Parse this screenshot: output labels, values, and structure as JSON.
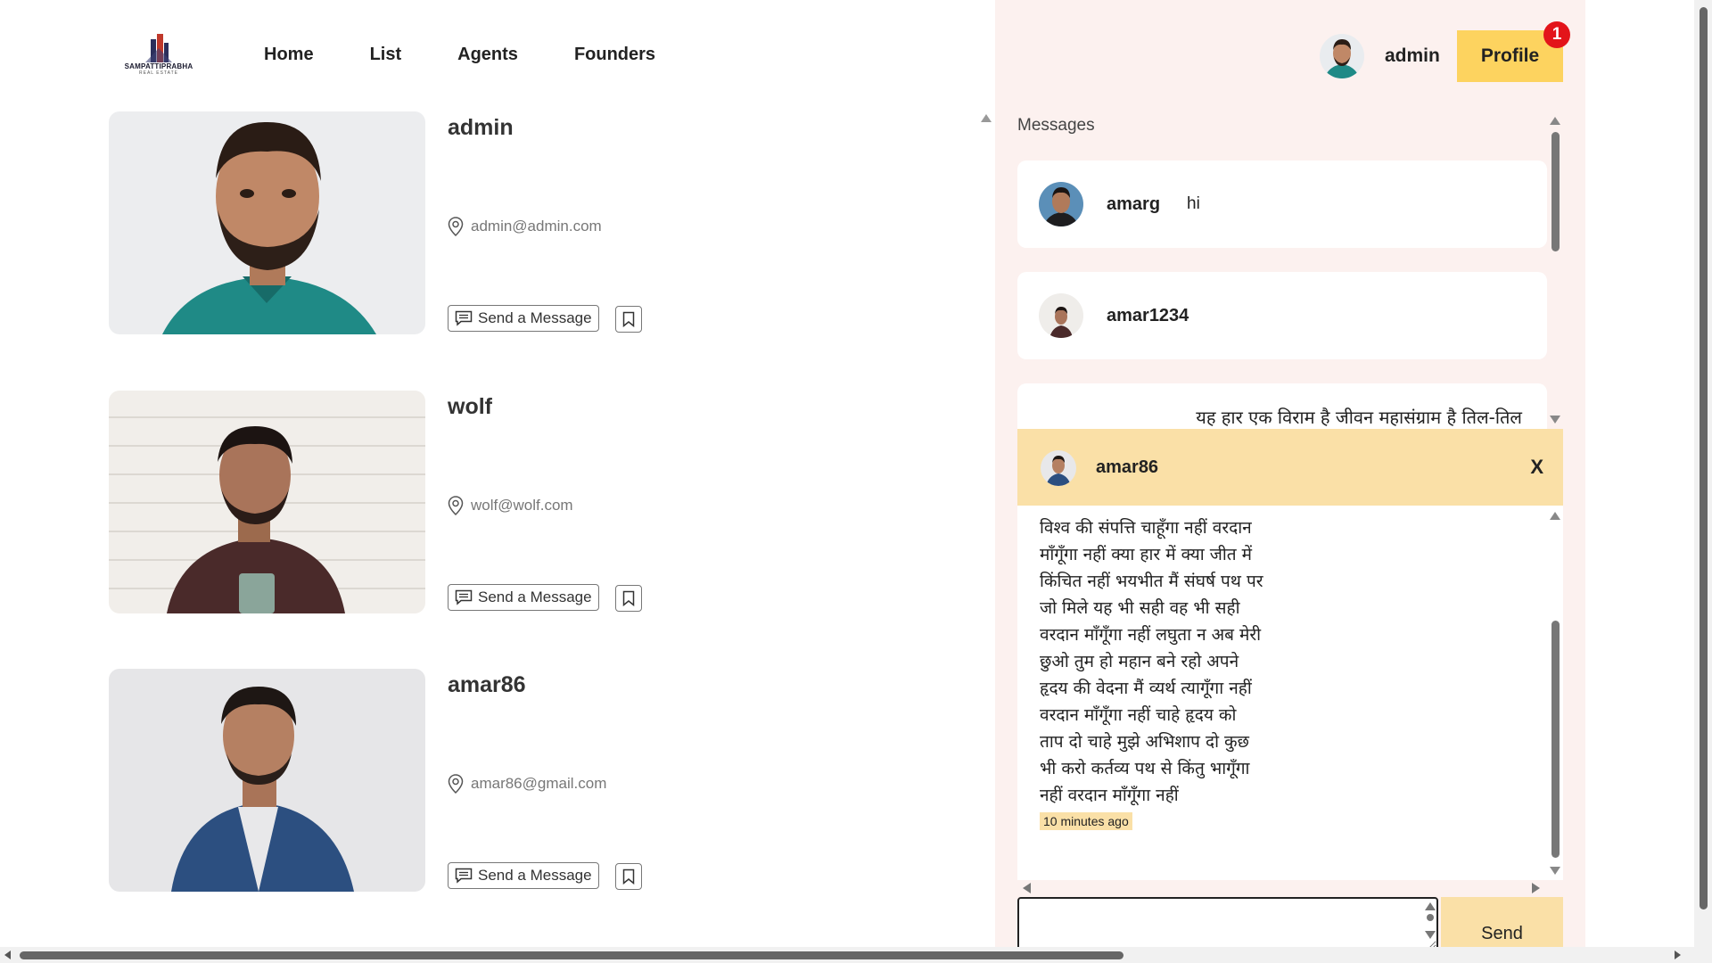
{
  "brand": {
    "name": "SAMPATTIPRABHA",
    "sub": "REAL ESTATE"
  },
  "nav": {
    "items": [
      "Home",
      "List",
      "Agents",
      "Founders"
    ]
  },
  "header": {
    "user_name": "admin",
    "profile_label": "Profile",
    "notification_count": "1"
  },
  "listings": [
    {
      "name": "admin",
      "email": "admin@admin.com",
      "message_label": "Send a Message"
    },
    {
      "name": "wolf",
      "email": "wolf@wolf.com",
      "message_label": "Send a Message"
    },
    {
      "name": "amar86",
      "email": "amar86@gmail.com",
      "message_label": "Send a Message"
    }
  ],
  "messages": {
    "label": "Messages",
    "conversations": [
      {
        "name": "amarg",
        "last": "hi"
      },
      {
        "name": "amar1234",
        "last": ""
      }
    ],
    "partial_text": "यह हार एक विराम है जीवन महासंग्राम है तिल-तिल"
  },
  "chat": {
    "name": "amar86",
    "close_label": "X",
    "lines": [
      "विश्व की संपत्ति चाहूँगा नहीं वरदान",
      "माँगूँगा नहीं क्या हार में क्या जीत में",
      "किंचित नहीं भयभीत मैं संघर्ष पथ पर",
      "जो मिले यह भी सही वह भी सही",
      "वरदान माँगूँगा नहीं लघुता न अब मेरी",
      "छुओ तुम हो महान बने रहो अपने",
      "हृदय की वेदना मैं व्यर्थ त्यागूँगा नहीं",
      "वरदान माँगूँगा नहीं चाहे हृदय को",
      "ताप दो चाहे मुझे अभिशाप दो कुछ",
      "भी करो कर्तव्य पथ से किंतु भागूँगा",
      "नहीं वरदान माँगूँगा नहीं"
    ],
    "time": "10 minutes ago",
    "input_value": "",
    "send_label": "Send"
  },
  "colors": {
    "accent": "#fdd35f",
    "chat_header": "#fae0a7",
    "panel_bg": "#fcf1ef",
    "badge": "#e3141a"
  },
  "icons": [
    "location-pin-icon",
    "message-icon",
    "bookmark-icon",
    "scroll-up-arrow-icon",
    "scroll-down-arrow-icon"
  ]
}
